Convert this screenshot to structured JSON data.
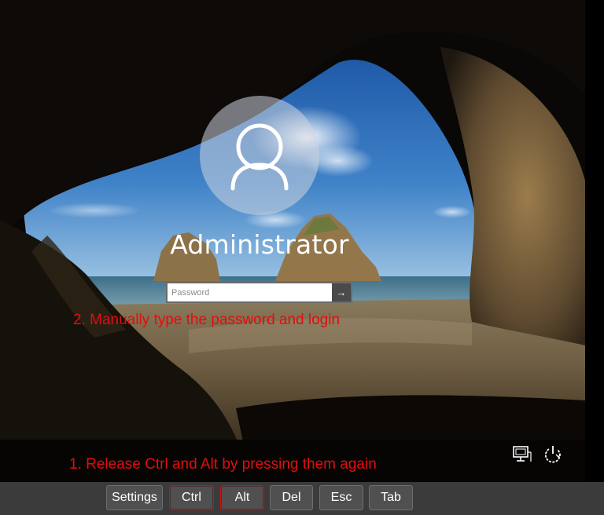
{
  "login": {
    "username": "Administrator",
    "password_placeholder": "Password",
    "submit_glyph": "→"
  },
  "annotations": {
    "step2": "2. Manually type the password and login",
    "step1": "1. Release Ctrl and Alt by pressing them again"
  },
  "corner_icons": {
    "network": "network-icon",
    "power": "power-icon"
  },
  "keybar": {
    "keys": [
      "Settings",
      "Ctrl",
      "Alt",
      "Del",
      "Esc",
      "Tab"
    ],
    "highlighted": [
      "Ctrl",
      "Alt"
    ]
  },
  "colors": {
    "annotation_red": "#e10e0e",
    "keybar_bg": "#3b3b3b",
    "key_bg": "#505050"
  }
}
